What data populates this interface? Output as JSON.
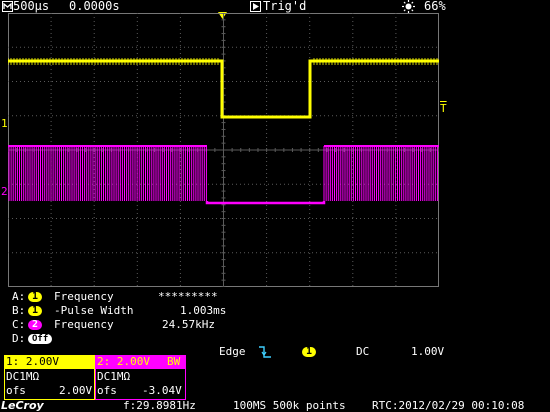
{
  "top": {
    "timebase": "500µs",
    "delay": "0.0000s",
    "status": "Trig'd",
    "brightness": "66%"
  },
  "markers": {
    "ch1": "1",
    "ch2": "2",
    "trigger_level": "T"
  },
  "measurements": [
    {
      "slot": "A:",
      "channel": "1",
      "channel_type": "ch1",
      "name": "Frequency",
      "value": "*********"
    },
    {
      "slot": "B:",
      "channel": "1",
      "channel_type": "ch1",
      "name": "-Pulse Width",
      "value": "1.003ms"
    },
    {
      "slot": "C:",
      "channel": "2",
      "channel_type": "ch2",
      "name": "Frequency",
      "value": "24.57kHz"
    },
    {
      "slot": "D:",
      "channel": "Off",
      "channel_type": "off",
      "name": "",
      "value": ""
    }
  ],
  "trigger": {
    "type": "Edge",
    "source": "1",
    "coupling": "DC",
    "level": "1.00V"
  },
  "ch1_panel": {
    "scale": "1: 2.00V",
    "coupling": "DC1MΩ",
    "offset_label": "ofs",
    "offset": "2.00V"
  },
  "ch2_panel": {
    "scale": "2: 2.00V",
    "bw": "BW",
    "coupling": "DC1MΩ",
    "offset_label": "ofs",
    "offset": "-3.04V"
  },
  "bottom": {
    "brand": "LeCroy",
    "frequency": "f:29.8981Hz",
    "sampling": "100MS 500k points",
    "rtc": "RTC:2012/02/29 00:10:08"
  },
  "colors": {
    "ch1": "#ffff00",
    "ch2": "#ff00ff",
    "grid": "#5a5a5a",
    "background": "#000000"
  },
  "icons": [
    "clock-icon",
    "run-play-icon",
    "trigger-point-icon",
    "brightness-icon",
    "falling-edge-icon"
  ]
}
